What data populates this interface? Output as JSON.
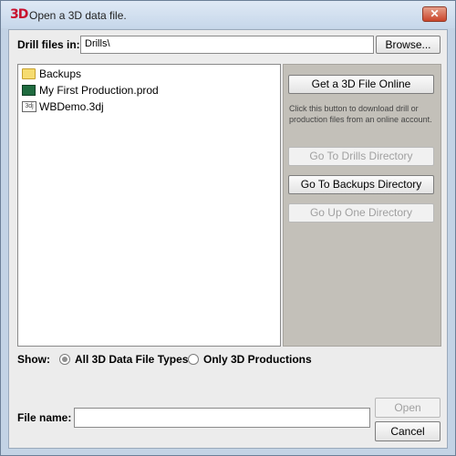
{
  "window": {
    "app_icon": "3D",
    "title": "Open a 3D data file.",
    "close_label": "✕"
  },
  "drill": {
    "label": "Drill files in:",
    "value": "Drills\\",
    "browse_label": "Browse..."
  },
  "files": [
    {
      "name": "Backups",
      "icon": "folder-icon"
    },
    {
      "name": "My First Production.prod",
      "icon": "production-file-icon"
    },
    {
      "name": "WBDemo.3dj",
      "icon": "3dj-file-icon"
    }
  ],
  "panel": {
    "online_label": "Get a 3D File Online",
    "online_text": "Click this button to download drill or production files from an online account.",
    "drills_dir_label": "Go To Drills Directory",
    "backups_dir_label": "Go To Backups Directory",
    "up_dir_label": "Go Up One Directory"
  },
  "show": {
    "label": "Show:",
    "options": [
      {
        "label": "All 3D Data File Types",
        "selected": true
      },
      {
        "label": "Only 3D Productions",
        "selected": false
      }
    ]
  },
  "filename": {
    "label": "File name:",
    "value": ""
  },
  "actions": {
    "open_label": "Open",
    "cancel_label": "Cancel"
  }
}
